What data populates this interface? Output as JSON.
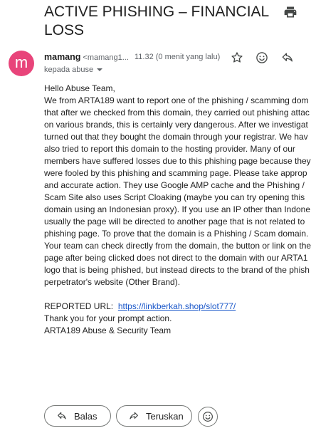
{
  "subject": "ACTIVE PHISHING – FINANCIAL LOSS",
  "sender": {
    "avatar_letter": "m",
    "name": "mamang",
    "email": "<mamang1...",
    "timestamp": "11.32 (0 menit yang lalu)",
    "recipient": "kepada abuse"
  },
  "colors": {
    "avatar": "#e8447a",
    "link": "#1a57c9"
  },
  "icons": [
    "print-icon",
    "star-icon",
    "emoji-icon",
    "reply-icon"
  ],
  "body": {
    "greeting": "Hello Abuse Team,",
    "paragraph_lines": [
      "We from ARTA189 want to report one of the phishing / scamming dom",
      "that after we checked from this domain, they carried out phishing attac",
      "on various brands, this is certainly very dangerous. After we investigat",
      "turned out that they bought the domain through your registrar. We hav",
      "also tried to report this domain to the hosting provider. Many of our",
      "members have suffered losses due to this phishing page because they",
      "were fooled by this phishing and scamming page. Please take approp",
      "and accurate action. They use Google AMP cache and the Phishing /",
      "Scam Site also uses Script Cloaking (maybe you can try opening this",
      "domain using an Indonesian proxy). If you use an IP other than Indone",
      "usually the page will be directed to another page that is not related to",
      "phishing page. To prove that the domain is a Phishing / Scam domain.",
      "Your team can check directly from the domain, the button or link on the",
      "page after being clicked does not direct to the domain with our ARTA1",
      "logo that is being phished, but instead directs to the brand of the phish",
      "perpetrator's website (Other Brand)."
    ],
    "reported_label": "REPORTED URL:",
    "reported_url": "https://linkberkah.shop/slot777/",
    "thanks": "Thank you for your prompt action.",
    "signature": "ARTA189 Abuse & Security Team"
  },
  "actions": {
    "reply_label": "Balas",
    "forward_label": "Teruskan"
  }
}
